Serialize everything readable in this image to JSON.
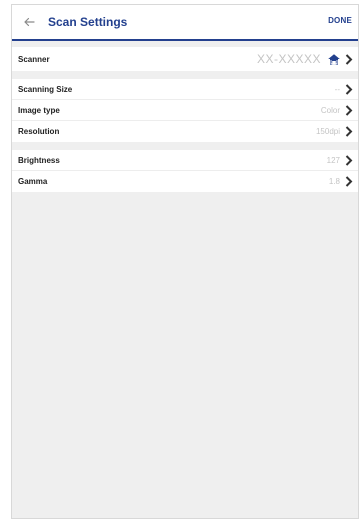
{
  "header": {
    "back_icon": "arrow-left-icon",
    "title": "Scan Settings",
    "done_label": "DONE",
    "accent_color": "#23408e"
  },
  "scanner": {
    "label": "Scanner",
    "value": "XX-XXXXX",
    "icon": "home-icon"
  },
  "scan_group": [
    {
      "label": "Scanning Size",
      "value": "--"
    },
    {
      "label": "Image type",
      "value": "Color"
    },
    {
      "label": "Resolution",
      "value": "150dpi"
    }
  ],
  "adjust_group": [
    {
      "label": "Brightness",
      "value": "127"
    },
    {
      "label": "Gamma",
      "value": "1.8"
    }
  ]
}
